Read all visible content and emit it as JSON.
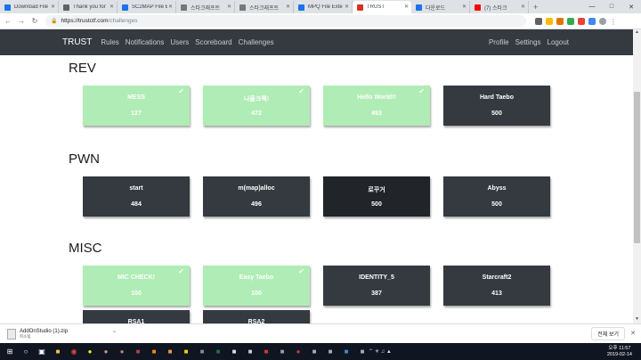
{
  "browser": {
    "tabs": [
      {
        "title": "Download File",
        "color": "#1a73e8"
      },
      {
        "title": "Thank you for",
        "color": "#5f6368"
      },
      {
        "title": "SC2MAP File E",
        "color": "#1a73e8"
      },
      {
        "title": "스타크래프트",
        "color": "#777"
      },
      {
        "title": "스타크래프트",
        "color": "#777"
      },
      {
        "title": "MPQ File Exte",
        "color": "#1a73e8"
      },
      {
        "title": "TRUST",
        "color": "#d93025"
      },
      {
        "title": "다운로드",
        "color": "#1a73e8"
      },
      {
        "title": "(7) 스타크",
        "color": "#ff0000"
      }
    ],
    "url_host": "https://trustctf.com",
    "url_path": "/challenges",
    "lock_icon": "lock-icon",
    "new_tab_label": "+"
  },
  "navbar": {
    "brand": "TRUST",
    "left_links": [
      "Rules",
      "Notifications",
      "Users",
      "Scoreboard",
      "Challenges"
    ],
    "right_links": [
      "Profile",
      "Settings",
      "Logout"
    ]
  },
  "categories": [
    {
      "name": "REV",
      "challenges": [
        {
          "name": "MESS",
          "points": "127",
          "solved": true,
          "style": "solved"
        },
        {
          "name": "나올크랙!",
          "points": "472",
          "solved": true,
          "style": "solved"
        },
        {
          "name": "Hello World!!",
          "points": "493",
          "solved": true,
          "style": "solved"
        },
        {
          "name": "Hard Taebo",
          "points": "500",
          "solved": false,
          "style": "unsolved"
        }
      ]
    },
    {
      "name": "PWN",
      "challenges": [
        {
          "name": "start",
          "points": "484",
          "solved": false,
          "style": "unsolved"
        },
        {
          "name": "m(map)alloc",
          "points": "496",
          "solved": false,
          "style": "unsolved"
        },
        {
          "name": "로꾸거",
          "points": "500",
          "solved": false,
          "style": "dark"
        },
        {
          "name": "Abyss",
          "points": "500",
          "solved": false,
          "style": "unsolved"
        }
      ]
    },
    {
      "name": "MISC",
      "challenges": [
        {
          "name": "MIC CHECK!",
          "points": "100",
          "solved": true,
          "style": "solved"
        },
        {
          "name": "Easy Taebo",
          "points": "100",
          "solved": true,
          "style": "solved"
        },
        {
          "name": "IDENTITY_5",
          "points": "387",
          "solved": false,
          "style": "unsolved"
        },
        {
          "name": "Starcraft2",
          "points": "413",
          "solved": false,
          "style": "unsolved"
        },
        {
          "name": "RSA1",
          "points": "",
          "solved": false,
          "style": "unsolved"
        },
        {
          "name": "RSA2",
          "points": "",
          "solved": false,
          "style": "unsolved"
        }
      ]
    }
  ],
  "download": {
    "file_name": "AddOnStudio (1).zip",
    "status": "취소됨",
    "show_all_label": "전체 보기"
  },
  "taskbar": {
    "time": "오후 11:57",
    "date": "2019-02-14"
  }
}
